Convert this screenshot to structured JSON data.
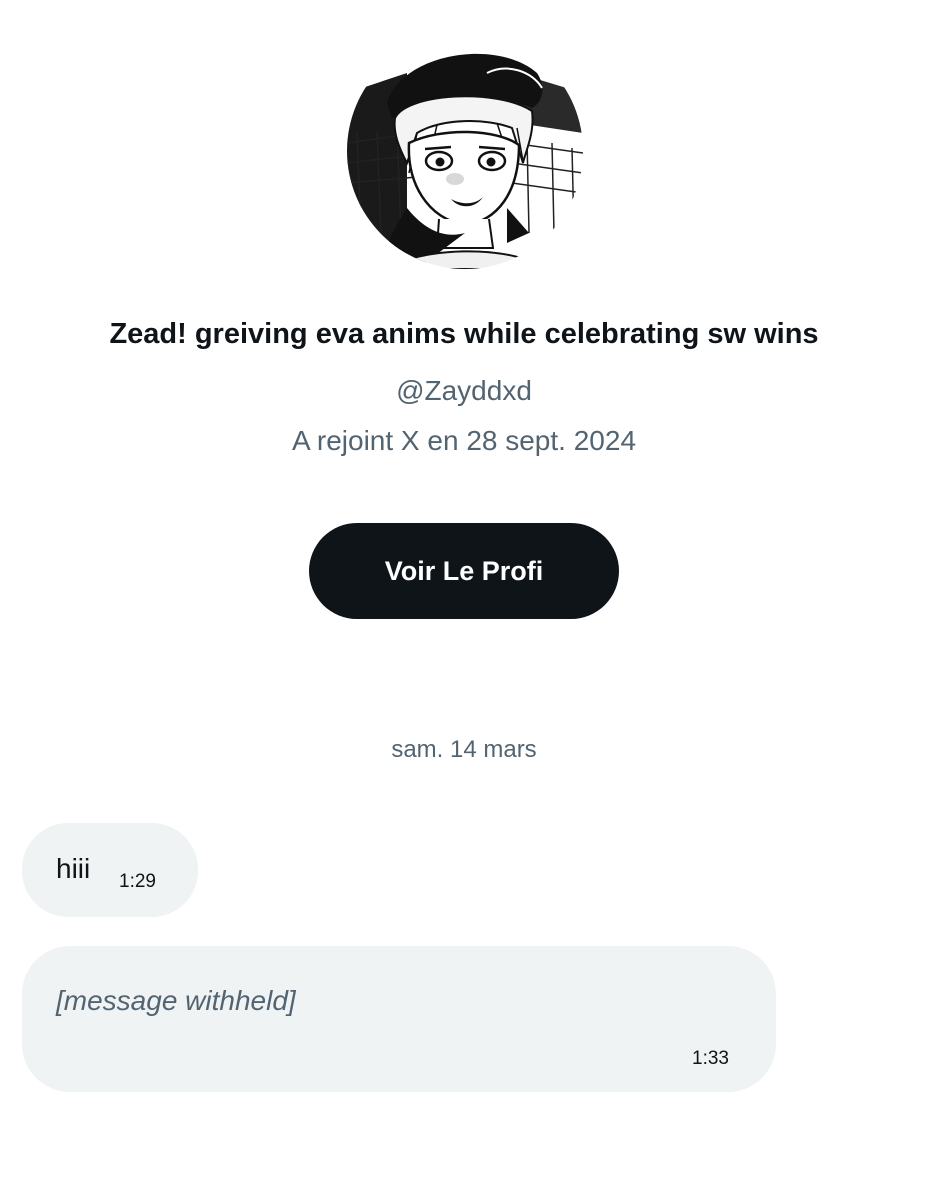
{
  "profile": {
    "avatar_icon": "anime-character-avatar",
    "display_name": "Zead! greiving eva anims while celebrating sw wins",
    "handle": "@Zayddxd",
    "joined": "A rejoint X en 28 sept. 2024",
    "view_profile_label": "Voir Le Profi"
  },
  "conversation": {
    "date_separator": "sam. 14 mars",
    "messages": [
      {
        "text": "hiii",
        "time": "1:29"
      },
      {
        "text": "[message withheld]",
        "time": "1:33"
      }
    ]
  },
  "colors": {
    "text_primary": "#0f1419",
    "text_secondary": "#536471",
    "button_bg": "#0f1419",
    "bubble_bg": "#eff3f4"
  }
}
